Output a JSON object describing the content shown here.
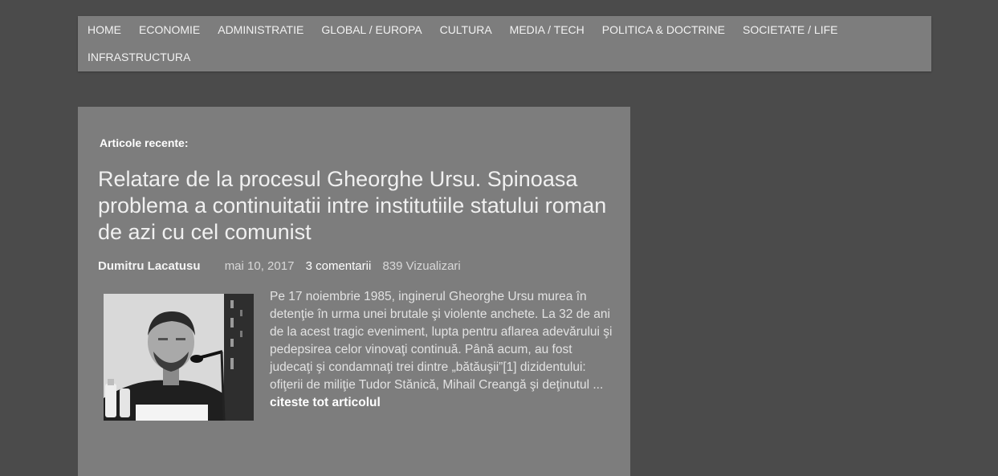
{
  "nav": {
    "items": [
      {
        "label": "HOME"
      },
      {
        "label": "ECONOMIE"
      },
      {
        "label": "ADMINISTRATIE"
      },
      {
        "label": "GLOBAL / EUROPA"
      },
      {
        "label": "CULTURA"
      },
      {
        "label": "MEDIA / TECH"
      },
      {
        "label": "POLITICA & DOCTRINE"
      },
      {
        "label": "SOCIETATE / LIFE"
      },
      {
        "label": "INFRASTRUCTURA"
      }
    ]
  },
  "main": {
    "recent_heading": "Articole recente:",
    "post": {
      "title": "Relatare de la procesul Gheorghe Ursu. Spinoasa problema a continuitatii intre institutiile statului roman de azi cu cel comunist",
      "author": "Dumitru Lacatusu",
      "date": "mai 10, 2017",
      "comments": "3 comentarii",
      "views": "839 Vizualizari",
      "excerpt": "Pe 17 noiembrie 1985, inginerul Gheorghe Ursu murea în detenţie în urma unei brutale şi violente anchete. La 32 de ani de la acest tragic eveniment, lupta pentru aflarea adevărului şi pedepsirea celor vinovaţi continuă. Până acum, au fost judecaţi şi condamnaţi trei dintre „bătăuşii”[1] dizidentului: ofiţerii de miliţie Tudor Stănică, Mihail Creangă şi deţinutul ... ",
      "read_more": "citeste tot articolul"
    }
  },
  "colors": {
    "page_background": "#4b4b4b",
    "panel_background": "#7d7d7d",
    "text_light": "#f0f0f0"
  }
}
